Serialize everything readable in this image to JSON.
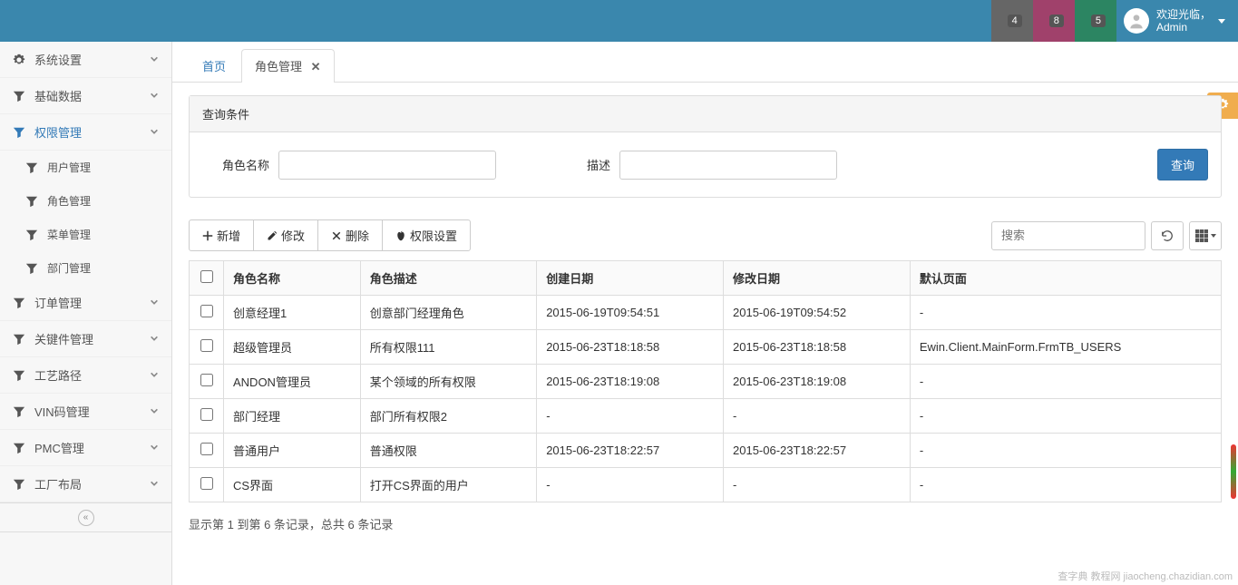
{
  "header": {
    "notify_bars": {
      "count": 4
    },
    "notify_bell": {
      "count": 8
    },
    "notify_mail": {
      "count": 5
    },
    "welcome_label": "欢迎光临，",
    "user_name": "Admin"
  },
  "sidebar": {
    "items": [
      {
        "label": "系统设置",
        "icon": "gear",
        "expandable": true,
        "open": false
      },
      {
        "label": "基础数据",
        "icon": "filter",
        "expandable": true,
        "open": false
      },
      {
        "label": "权限管理",
        "icon": "filter",
        "expandable": true,
        "open": true,
        "active": true,
        "children": [
          {
            "label": "用户管理"
          },
          {
            "label": "角色管理"
          },
          {
            "label": "菜单管理"
          },
          {
            "label": "部门管理"
          }
        ]
      },
      {
        "label": "订单管理",
        "icon": "filter",
        "expandable": true,
        "open": false
      },
      {
        "label": "关键件管理",
        "icon": "filter",
        "expandable": true,
        "open": false
      },
      {
        "label": "工艺路径",
        "icon": "filter",
        "expandable": true,
        "open": false
      },
      {
        "label": "VIN码管理",
        "icon": "filter",
        "expandable": true,
        "open": false
      },
      {
        "label": "PMC管理",
        "icon": "filter",
        "expandable": true,
        "open": false
      },
      {
        "label": "工厂布局",
        "icon": "filter",
        "expandable": true,
        "open": false
      }
    ]
  },
  "tabs": {
    "home_label": "首页",
    "active_label": "角色管理"
  },
  "filter": {
    "panel_title": "查询条件",
    "name_label": "角色名称",
    "desc_label": "描述",
    "query_btn": "查询"
  },
  "toolbar": {
    "add": "新增",
    "edit": "修改",
    "delete": "删除",
    "perm": "权限设置",
    "search_placeholder": "搜索"
  },
  "table": {
    "headers": {
      "name": "角色名称",
      "desc": "角色描述",
      "created": "创建日期",
      "modified": "修改日期",
      "default_page": "默认页面"
    },
    "rows": [
      {
        "name": "创意经理1",
        "desc": "创意部门经理角色",
        "created": "2015-06-19T09:54:51",
        "modified": "2015-06-19T09:54:52",
        "default_page": "-"
      },
      {
        "name": "超级管理员",
        "desc": "所有权限111",
        "created": "2015-06-23T18:18:58",
        "modified": "2015-06-23T18:18:58",
        "default_page": "Ewin.Client.MainForm.FrmTB_USERS"
      },
      {
        "name": "ANDON管理员",
        "desc": "某个领域的所有权限",
        "created": "2015-06-23T18:19:08",
        "modified": "2015-06-23T18:19:08",
        "default_page": "-"
      },
      {
        "name": "部门经理",
        "desc": "部门所有权限2",
        "created": "-",
        "modified": "-",
        "default_page": "-"
      },
      {
        "name": "普通用户",
        "desc": "普通权限",
        "created": "2015-06-23T18:22:57",
        "modified": "2015-06-23T18:22:57",
        "default_page": "-"
      },
      {
        "name": "CS界面",
        "desc": "打开CS界面的用户",
        "created": "-",
        "modified": "-",
        "default_page": "-"
      }
    ]
  },
  "pager": {
    "info": "显示第 1 到第 6 条记录，总共 6 条记录"
  },
  "watermark": "查字典 教程网  jiaocheng.chazidian.com"
}
